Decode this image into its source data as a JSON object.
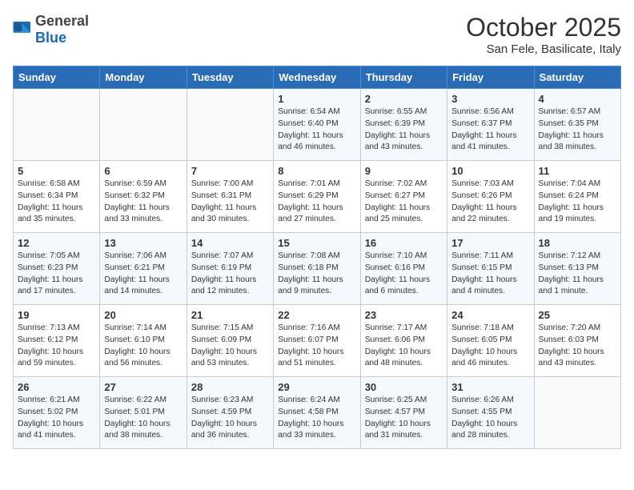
{
  "header": {
    "logo_general": "General",
    "logo_blue": "Blue",
    "title": "October 2025",
    "subtitle": "San Fele, Basilicate, Italy"
  },
  "weekdays": [
    "Sunday",
    "Monday",
    "Tuesday",
    "Wednesday",
    "Thursday",
    "Friday",
    "Saturday"
  ],
  "weeks": [
    [
      {
        "day": "",
        "content": ""
      },
      {
        "day": "",
        "content": ""
      },
      {
        "day": "",
        "content": ""
      },
      {
        "day": "1",
        "content": "Sunrise: 6:54 AM\nSunset: 6:40 PM\nDaylight: 11 hours and 46 minutes."
      },
      {
        "day": "2",
        "content": "Sunrise: 6:55 AM\nSunset: 6:39 PM\nDaylight: 11 hours and 43 minutes."
      },
      {
        "day": "3",
        "content": "Sunrise: 6:56 AM\nSunset: 6:37 PM\nDaylight: 11 hours and 41 minutes."
      },
      {
        "day": "4",
        "content": "Sunrise: 6:57 AM\nSunset: 6:35 PM\nDaylight: 11 hours and 38 minutes."
      }
    ],
    [
      {
        "day": "5",
        "content": "Sunrise: 6:58 AM\nSunset: 6:34 PM\nDaylight: 11 hours and 35 minutes."
      },
      {
        "day": "6",
        "content": "Sunrise: 6:59 AM\nSunset: 6:32 PM\nDaylight: 11 hours and 33 minutes."
      },
      {
        "day": "7",
        "content": "Sunrise: 7:00 AM\nSunset: 6:31 PM\nDaylight: 11 hours and 30 minutes."
      },
      {
        "day": "8",
        "content": "Sunrise: 7:01 AM\nSunset: 6:29 PM\nDaylight: 11 hours and 27 minutes."
      },
      {
        "day": "9",
        "content": "Sunrise: 7:02 AM\nSunset: 6:27 PM\nDaylight: 11 hours and 25 minutes."
      },
      {
        "day": "10",
        "content": "Sunrise: 7:03 AM\nSunset: 6:26 PM\nDaylight: 11 hours and 22 minutes."
      },
      {
        "day": "11",
        "content": "Sunrise: 7:04 AM\nSunset: 6:24 PM\nDaylight: 11 hours and 19 minutes."
      }
    ],
    [
      {
        "day": "12",
        "content": "Sunrise: 7:05 AM\nSunset: 6:23 PM\nDaylight: 11 hours and 17 minutes."
      },
      {
        "day": "13",
        "content": "Sunrise: 7:06 AM\nSunset: 6:21 PM\nDaylight: 11 hours and 14 minutes."
      },
      {
        "day": "14",
        "content": "Sunrise: 7:07 AM\nSunset: 6:19 PM\nDaylight: 11 hours and 12 minutes."
      },
      {
        "day": "15",
        "content": "Sunrise: 7:08 AM\nSunset: 6:18 PM\nDaylight: 11 hours and 9 minutes."
      },
      {
        "day": "16",
        "content": "Sunrise: 7:10 AM\nSunset: 6:16 PM\nDaylight: 11 hours and 6 minutes."
      },
      {
        "day": "17",
        "content": "Sunrise: 7:11 AM\nSunset: 6:15 PM\nDaylight: 11 hours and 4 minutes."
      },
      {
        "day": "18",
        "content": "Sunrise: 7:12 AM\nSunset: 6:13 PM\nDaylight: 11 hours and 1 minute."
      }
    ],
    [
      {
        "day": "19",
        "content": "Sunrise: 7:13 AM\nSunset: 6:12 PM\nDaylight: 10 hours and 59 minutes."
      },
      {
        "day": "20",
        "content": "Sunrise: 7:14 AM\nSunset: 6:10 PM\nDaylight: 10 hours and 56 minutes."
      },
      {
        "day": "21",
        "content": "Sunrise: 7:15 AM\nSunset: 6:09 PM\nDaylight: 10 hours and 53 minutes."
      },
      {
        "day": "22",
        "content": "Sunrise: 7:16 AM\nSunset: 6:07 PM\nDaylight: 10 hours and 51 minutes."
      },
      {
        "day": "23",
        "content": "Sunrise: 7:17 AM\nSunset: 6:06 PM\nDaylight: 10 hours and 48 minutes."
      },
      {
        "day": "24",
        "content": "Sunrise: 7:18 AM\nSunset: 6:05 PM\nDaylight: 10 hours and 46 minutes."
      },
      {
        "day": "25",
        "content": "Sunrise: 7:20 AM\nSunset: 6:03 PM\nDaylight: 10 hours and 43 minutes."
      }
    ],
    [
      {
        "day": "26",
        "content": "Sunrise: 6:21 AM\nSunset: 5:02 PM\nDaylight: 10 hours and 41 minutes."
      },
      {
        "day": "27",
        "content": "Sunrise: 6:22 AM\nSunset: 5:01 PM\nDaylight: 10 hours and 38 minutes."
      },
      {
        "day": "28",
        "content": "Sunrise: 6:23 AM\nSunset: 4:59 PM\nDaylight: 10 hours and 36 minutes."
      },
      {
        "day": "29",
        "content": "Sunrise: 6:24 AM\nSunset: 4:58 PM\nDaylight: 10 hours and 33 minutes."
      },
      {
        "day": "30",
        "content": "Sunrise: 6:25 AM\nSunset: 4:57 PM\nDaylight: 10 hours and 31 minutes."
      },
      {
        "day": "31",
        "content": "Sunrise: 6:26 AM\nSunset: 4:55 PM\nDaylight: 10 hours and 28 minutes."
      },
      {
        "day": "",
        "content": ""
      }
    ]
  ]
}
